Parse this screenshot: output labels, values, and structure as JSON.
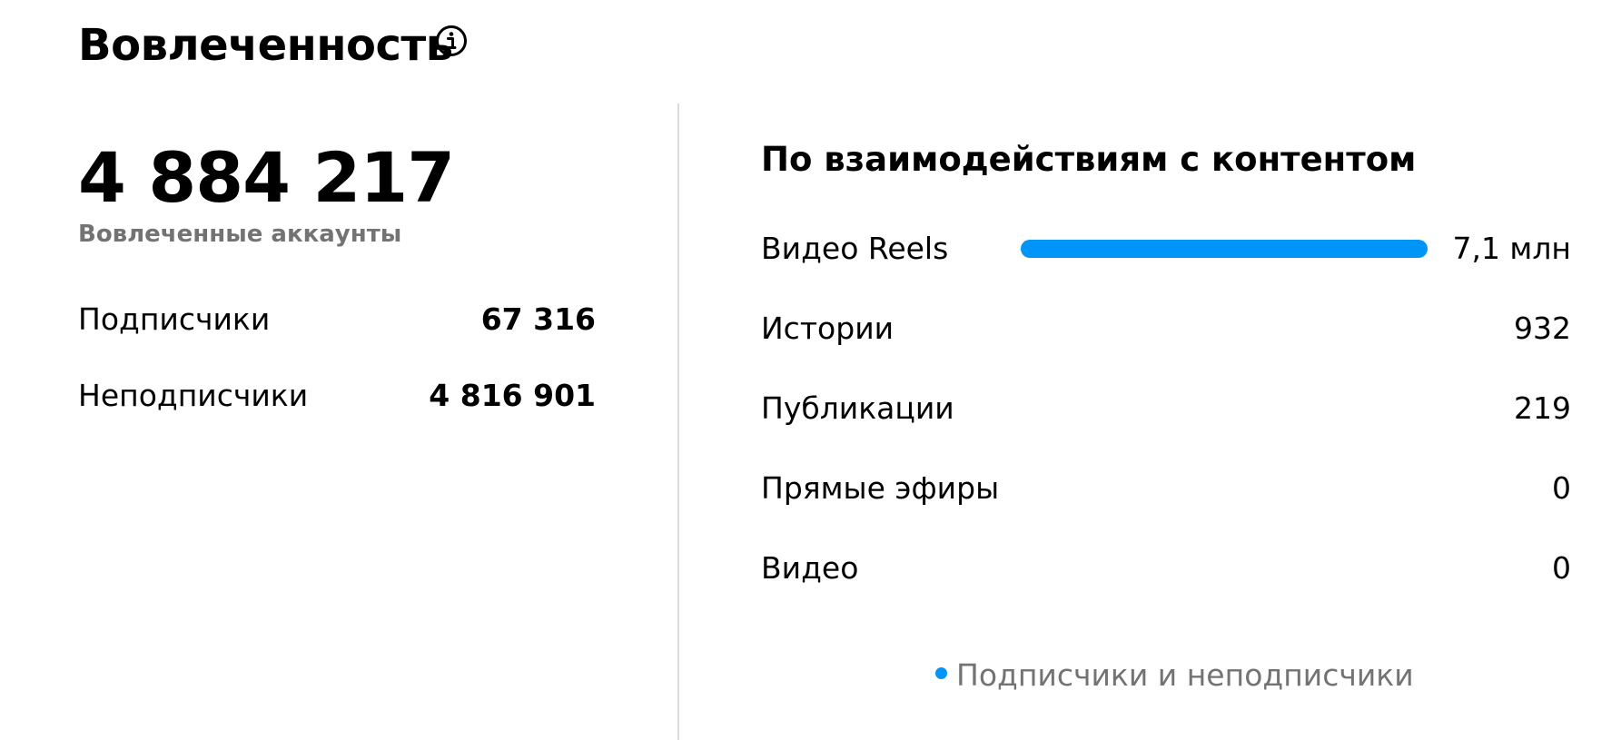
{
  "header": {
    "title": "Вовлеченность",
    "info_icon": "info-icon"
  },
  "summary": {
    "total_value": "4 884 217",
    "total_label": "Вовлеченные аккаунты",
    "rows": [
      {
        "label": "Подписчики",
        "value": "67 316"
      },
      {
        "label": "Неподписчики",
        "value": "4 816 901"
      }
    ]
  },
  "content_breakdown": {
    "title": "По взаимодействиям с контентом",
    "accent_color": "#0095f6",
    "items": [
      {
        "label": "Видео Reels",
        "value": "7,1 млн",
        "fill": 1.0
      },
      {
        "label": "Истории",
        "value": "932",
        "fill": 0.0
      },
      {
        "label": "Публикации",
        "value": "219",
        "fill": 0.0
      },
      {
        "label": "Прямые эфиры",
        "value": "0",
        "fill": 0.0
      },
      {
        "label": "Видео",
        "value": "0",
        "fill": 0.0
      }
    ],
    "legend": {
      "label": "Подписчики и неподписчики",
      "color": "#0095f6"
    }
  }
}
